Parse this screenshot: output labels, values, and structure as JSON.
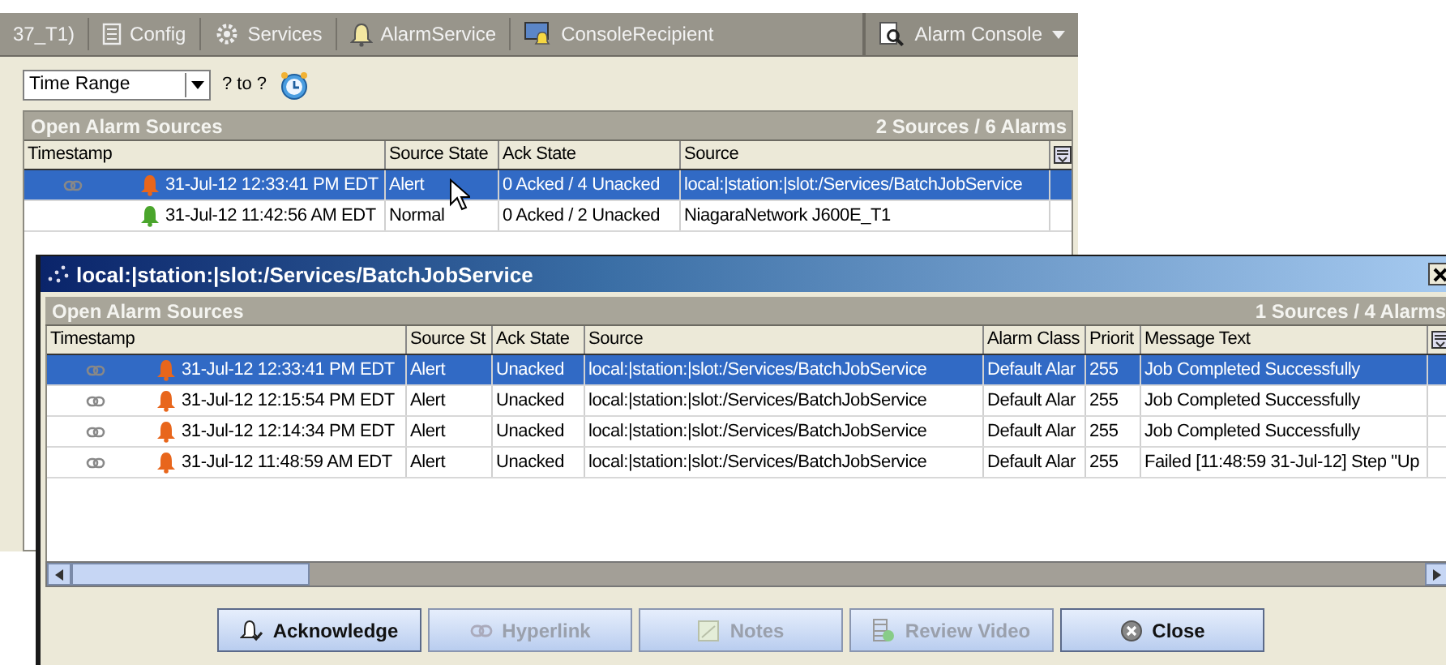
{
  "nav_bar": {
    "items": [
      {
        "kind": "text",
        "label": "37_T1)"
      },
      {
        "kind": "doc",
        "label": "Config"
      },
      {
        "kind": "gear",
        "label": "Services"
      },
      {
        "kind": "bell",
        "label": "AlarmService"
      },
      {
        "kind": "monitor",
        "label": "ConsoleRecipient"
      }
    ],
    "view_button": "Alarm Console"
  },
  "filter": {
    "select_value": "Time Range",
    "range_text": "? to ?"
  },
  "main_table": {
    "title": "Open Alarm Sources",
    "summary": "2 Sources / 6 Alarms",
    "columns": [
      "Timestamp",
      "Source State",
      "Ack State",
      "Source"
    ],
    "rows": [
      {
        "selected": true,
        "linked": true,
        "color": "#e8661c",
        "cells": [
          "31-Jul-12 12:33:41 PM EDT",
          "Alert",
          "0 Acked / 4 Unacked",
          "local:|station:|slot:/Services/BatchJobService"
        ]
      },
      {
        "selected": false,
        "linked": false,
        "color": "#4aa52c",
        "cells": [
          "31-Jul-12 11:42:56 AM EDT",
          "Normal",
          "0 Acked / 2 Unacked",
          "NiagaraNetwork J600E_T1"
        ]
      }
    ]
  },
  "dialog": {
    "title": "local:|station:|slot:/Services/BatchJobService",
    "table_title": "Open Alarm Sources",
    "summary": "1 Sources / 4 Alarms",
    "columns": [
      "Timestamp",
      "Source St",
      "Ack State",
      "Source",
      "Alarm Class",
      "Priorit",
      "Message Text"
    ],
    "rows": [
      {
        "selected": true,
        "linked": true,
        "color": "#e8661c",
        "cells": [
          "31-Jul-12 12:33:41 PM EDT",
          "Alert",
          "Unacked",
          "local:|station:|slot:/Services/BatchJobService",
          "Default Alar",
          "255",
          "Job Completed Successfully"
        ]
      },
      {
        "selected": false,
        "linked": true,
        "color": "#e8661c",
        "cells": [
          "31-Jul-12 12:15:54 PM EDT",
          "Alert",
          "Unacked",
          "local:|station:|slot:/Services/BatchJobService",
          "Default Alar",
          "255",
          "Job Completed Successfully"
        ]
      },
      {
        "selected": false,
        "linked": true,
        "color": "#e8661c",
        "cells": [
          "31-Jul-12 12:14:34 PM EDT",
          "Alert",
          "Unacked",
          "local:|station:|slot:/Services/BatchJobService",
          "Default Alar",
          "255",
          "Job Completed Successfully"
        ]
      },
      {
        "selected": false,
        "linked": true,
        "color": "#e8661c",
        "cells": [
          "31-Jul-12 11:48:59 AM EDT",
          "Alert",
          "Unacked",
          "local:|station:|slot:/Services/BatchJobService",
          "Default Alar",
          "255",
          "Failed [11:48:59 31-Jul-12] Step \"Up"
        ]
      }
    ],
    "buttons": [
      {
        "kind": "acknowledge",
        "label": "Acknowledge",
        "disabled": false
      },
      {
        "kind": "hyperlink",
        "label": "Hyperlink",
        "disabled": true
      },
      {
        "kind": "notes",
        "label": "Notes",
        "disabled": true
      },
      {
        "kind": "video",
        "label": "Review Video",
        "disabled": true
      },
      {
        "kind": "close",
        "label": "Close",
        "disabled": false
      }
    ]
  }
}
